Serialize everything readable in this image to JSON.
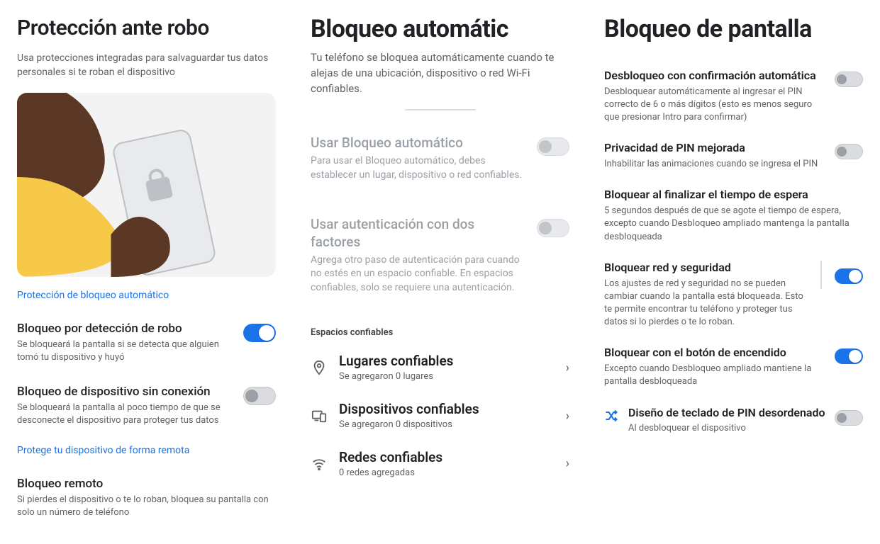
{
  "col1": {
    "title": "Protección ante robo",
    "subtitle": "Usa protecciones integradas para salvaguardar tus datos personales si te roban el dispositivo",
    "link1": "Protección de bloqueo automático",
    "item1": {
      "title": "Bloqueo por detección de robo",
      "desc": "Se bloqueará la pantalla si se detecta que alguien tomó tu dispositivo y huyó"
    },
    "item2": {
      "title": "Bloqueo de dispositivo sin conexión",
      "desc": "Se bloqueará la pantalla al poco tiempo de que se desconecte el dispositivo para proteger tus datos"
    },
    "link2": "Protege tu dispositivo de forma remota",
    "item3": {
      "title": "Bloqueo remoto",
      "desc": "Si pierdes el dispositivo o te lo roban, bloquea su pantalla con solo un número de teléfono"
    }
  },
  "col2": {
    "title": "Bloqueo automátic",
    "subtitle": "Tu teléfono se bloquea automáticamente cuando te alejas de una ubicación, dispositivo o red Wi-Fi confiables.",
    "item1": {
      "title": "Usar Bloqueo automático",
      "desc": "Para usar el Bloqueo automático, debes establecer un lugar, dispositivo o red confiables."
    },
    "item2": {
      "title": "Usar autenticación con dos factores",
      "desc": "Agrega otro paso de autenticación para cuando no estés en un espacio confiable. En espacios confiables, solo se requiere una autenticación."
    },
    "section": "Espacios confiables",
    "rows": [
      {
        "title": "Lugares confiables",
        "sub": "Se agregaron 0 lugares"
      },
      {
        "title": "Dispositivos confiables",
        "sub": "Se agregaron 0 dispositivos"
      },
      {
        "title": "Redes confiables",
        "sub": "0 redes agregadas"
      }
    ]
  },
  "col3": {
    "title": "Bloqueo de pantalla",
    "items": [
      {
        "title": "Desbloqueo con confirmación automática",
        "desc": "Desbloquear automáticamente al ingresar el PIN correcto de 6 o más dígitos (esto es menos seguro que presionar Intro para confirmar)",
        "on": false
      },
      {
        "title": "Privacidad de PIN mejorada",
        "desc": "Inhabilitar las animaciones cuando se ingresa el PIN",
        "on": false
      },
      {
        "title": "Bloquear al finalizar el tiempo de espera",
        "desc": "5 segundos después de que se agote el tiempo de espera, excepto cuando Desbloqueo ampliado mantenga la pantalla desbloqueada",
        "on": null
      },
      {
        "title": "Bloquear red y seguridad",
        "desc": "Los ajustes de red y seguridad no se pueden cambiar cuando la pantalla está bloqueada. Esto te permite encontrar tu teléfono y proteger tus datos si lo pierdes o te lo roban.",
        "on": true,
        "rule": true
      },
      {
        "title": "Bloquear con el botón de encendido",
        "desc": "Excepto cuando Desbloqueo ampliado mantiene la pantalla desbloqueada",
        "on": true
      }
    ],
    "last": {
      "title": "Diseño de teclado de PIN desordenado",
      "desc": "Al desbloquear el dispositivo"
    }
  }
}
